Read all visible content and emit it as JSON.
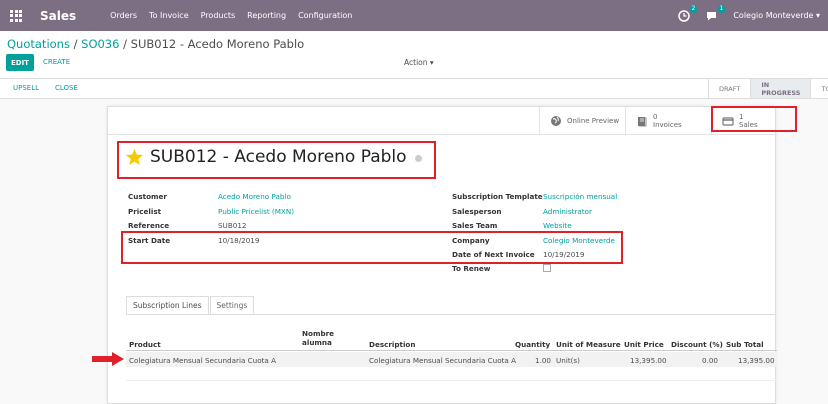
{
  "navbar": {
    "brand": "Sales",
    "menu": [
      "Orders",
      "To Invoice",
      "Products",
      "Reporting",
      "Configuration"
    ],
    "activity_count": "2",
    "message_count": "1",
    "company": "Colegio Monteverde",
    "bg_color": "#7c6f83"
  },
  "breadcrumb": {
    "root": "Quotations",
    "sep1": " / ",
    "parent": "SO036",
    "sep2": " / ",
    "current": "SUB012 - Acedo Moreno Pablo"
  },
  "buttons": {
    "edit": "EDIT",
    "create": "CREATE",
    "action": "Action",
    "upsell": "UPSELL",
    "close": "CLOSE"
  },
  "stages": [
    "DRAFT",
    "IN PROGRESS",
    "TO"
  ],
  "active_stage": "IN PROGRESS",
  "smart_buttons": {
    "online_preview": "Online Preview",
    "invoices_count": "0",
    "invoices_label": "Invoices",
    "sales_count": "1",
    "sales_label": "Sales"
  },
  "record": {
    "title": "SUB012 - Acedo Moreno Pablo",
    "left_fields": [
      {
        "label": "Customer",
        "value": "Acedo Moreno Pablo"
      },
      {
        "label": "Pricelist",
        "value": "Public Pricelist (MXN)"
      },
      {
        "label": "Reference",
        "value": "SUB012"
      },
      {
        "label": "Start Date",
        "value": "10/18/2019"
      }
    ],
    "right_fields": [
      {
        "label": "Subscription Template",
        "value": "Suscripción mensual"
      },
      {
        "label": "Salesperson",
        "value": "Administrator"
      },
      {
        "label": "Sales Team",
        "value": "Website"
      },
      {
        "label": "Company",
        "value": "Colegio Monteverde"
      },
      {
        "label": "Date of Next Invoice",
        "value": "10/19/2019"
      },
      {
        "label": "To Renew",
        "value": ""
      }
    ]
  },
  "tabs": [
    "Subscription Lines",
    "Settings"
  ],
  "lines_table": {
    "headers": {
      "product": "Product",
      "nombre1": "Nombre",
      "nombre2": "alumna",
      "description": "Description",
      "quantity": "Quantity",
      "uom": "Unit of Measure",
      "unit_price": "Unit Price",
      "discount": "Discount (%)",
      "subtotal": "Sub Total"
    },
    "rows": [
      {
        "product": "Colegiatura Mensual Secundaria Cuota A",
        "description": "Colegiatura Mensual Secundaria Cuota A",
        "quantity": "1.00",
        "uom": "Unit(s)",
        "unit_price": "13,395.00",
        "discount": "0.00",
        "subtotal": "13,395.00"
      }
    ]
  },
  "colors": {
    "accent": "#00a09d",
    "highlight_red": "#e0202b"
  }
}
